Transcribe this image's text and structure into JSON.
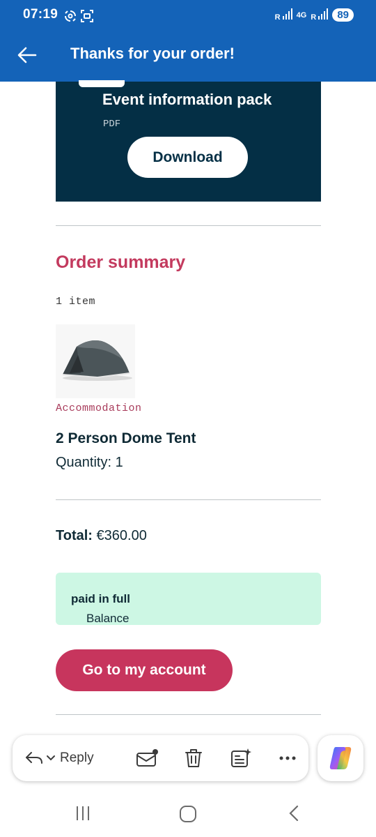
{
  "status_bar": {
    "time": "07:19",
    "network_left": "R",
    "network_mid": "4G",
    "network_right": "R",
    "battery": "89"
  },
  "app_bar": {
    "title": "Thanks for your order!"
  },
  "event_pack": {
    "title": "Event information pack",
    "file_type": "PDF",
    "download_label": "Download"
  },
  "order_summary": {
    "heading": "Order summary",
    "item_count": "1 item",
    "item": {
      "category": "Accommodation",
      "name": "2 Person Dome Tent",
      "quantity": "Quantity: 1"
    }
  },
  "total": {
    "label": "Total:",
    "value": "€360.00"
  },
  "balance": {
    "prefix": "Balance",
    "status": "paid in full"
  },
  "account_button": "Go to my account",
  "toolbar": {
    "reply_label": "Reply"
  },
  "colors": {
    "app_bar": "#1463b8",
    "hero_bg": "#042f45",
    "accent": "#c7355d",
    "balance_bg": "#cdf7e4"
  }
}
